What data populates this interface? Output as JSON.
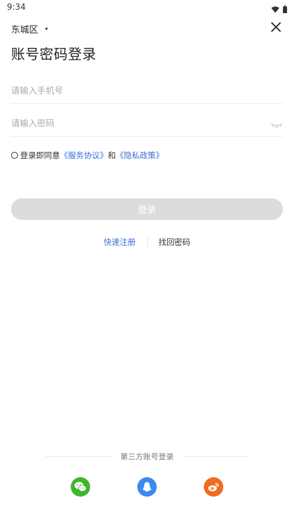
{
  "status_bar": {
    "time": "9:34"
  },
  "header": {
    "city": "东城区",
    "title": "账号密码登录"
  },
  "form": {
    "phone_placeholder": "请输入手机号",
    "password_placeholder": "请输入密码"
  },
  "agreement": {
    "prefix": "登录即同意",
    "service_link": "《服务协议》",
    "and": "和",
    "privacy_link": "《隐私政策》"
  },
  "login_button": "登录",
  "links": {
    "quick_register": "快速注册",
    "find_password": "找回密码"
  },
  "third_party": {
    "label": "第三方账号登录",
    "providers": [
      "wechat",
      "qq",
      "weibo"
    ]
  },
  "colors": {
    "accent_blue": "#3a6fd6",
    "button_disabled": "#dcdcdc",
    "wechat": "#3fb52a",
    "qq": "#3b8af0",
    "weibo": "#f26b1d"
  }
}
